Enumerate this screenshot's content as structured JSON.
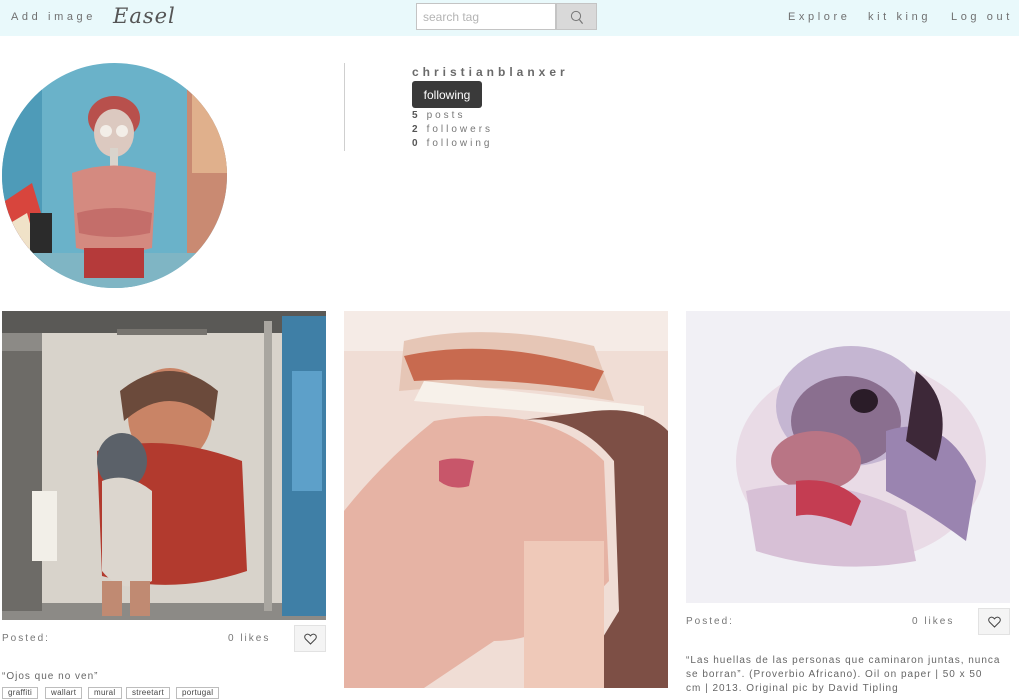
{
  "nav": {
    "add_image": "Add image",
    "logo": "Easel",
    "search_placeholder": "search tag",
    "explore": "Explore",
    "user": "kit king",
    "logout": "Log out"
  },
  "profile": {
    "username": "christianblanxer",
    "follow_label": "following",
    "posts_count": "5",
    "posts_label": "posts",
    "followers_count": "2",
    "followers_label": "followers",
    "following_count": "0",
    "following_label": "following"
  },
  "posts": [
    {
      "posted": "Posted:",
      "likes": "0 likes",
      "caption": "“Ojos que no ven”",
      "tags": [
        "graffiti",
        "wallart",
        "mural",
        "streetart",
        "portugal"
      ]
    },
    {
      "posted": "",
      "likes": "",
      "caption": "",
      "tags": []
    },
    {
      "posted": "Posted:",
      "likes": "0 likes",
      "caption_lines": [
        "“Las huellas de las personas que caminaron juntas, nunca",
        "se borran”. (Proverbio Africano). Oil on paper | 50 x 50",
        "cm | 2013. Original pic by David Tipling"
      ],
      "tags": []
    }
  ],
  "icons": {
    "search": "search-icon",
    "heart": "heart-icon"
  },
  "colors": {
    "topbar": "#e9f9fb",
    "follow_button": "#3a3a3a"
  }
}
